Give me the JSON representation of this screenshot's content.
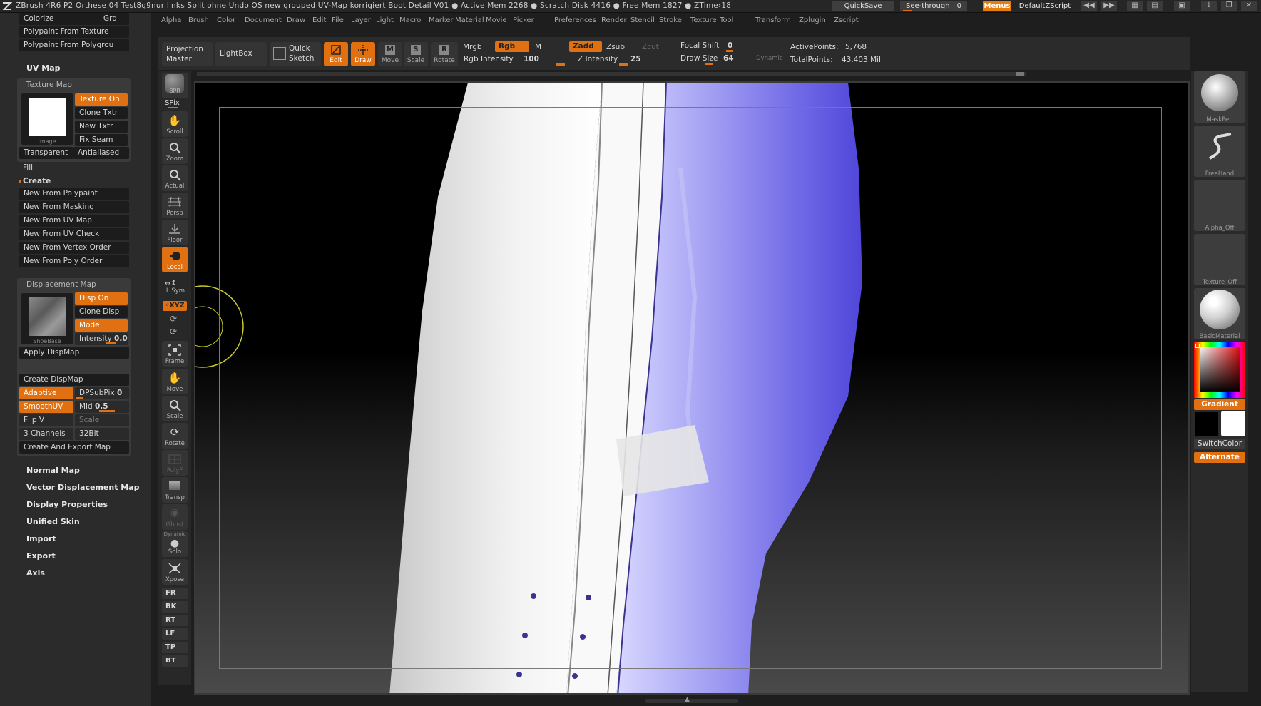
{
  "titlebar": {
    "title": "ZBrush 4R6 P2   Orthese 04 Test8g9nur links Split ohne Undo OS new grouped UV-Map korrigiert Boot Detail V01   ● Active Mem 2268 ● Scratch Disk 4416 ● Free Mem 1827 ● ZTime›18",
    "quicksave": "QuickSave",
    "seethrough_label": "See-through",
    "seethrough_value": "0",
    "menus": "Menus",
    "script": "DefaultZScript"
  },
  "menubar": {
    "items": [
      "Alpha",
      "Brush",
      "Color",
      "Document",
      "Draw",
      "Edit",
      "File",
      "Layer",
      "Light",
      "Macro",
      "Marker",
      "Material",
      "Movie",
      "Picker",
      "Preferences",
      "Render",
      "Stencil",
      "Stroke",
      "Texture",
      "Tool",
      "Transform",
      "Zplugin",
      "Zscript"
    ]
  },
  "left": {
    "colorize": "Colorize",
    "grd": "Grd",
    "polypaint_from_texture": "Polypaint From Texture",
    "polypaint_from_polygroups": "Polypaint From Polygrou",
    "uv_map": "UV Map",
    "texture_map": {
      "header": "Texture Map",
      "texture_on": "Texture On",
      "clone_txtr": "Clone Txtr",
      "new_txtr": "New Txtr",
      "fix_seam": "Fix Seam",
      "image_caption": "Image",
      "transparent": "Transparent",
      "antialiased": "Antialiased",
      "fill": "Fill",
      "create": "Create",
      "new_from": [
        "New From Polypaint",
        "New From Masking",
        "New From UV Map",
        "New From UV Check",
        "New From Vertex Order",
        "New From Poly Order"
      ]
    },
    "displacement_map": {
      "header": "Displacement Map",
      "disp_on": "Disp On",
      "clone_disp": "Clone Disp",
      "mode": "Mode",
      "intensity_label": "Intensity",
      "intensity_value": "0.0",
      "image_caption": "ShoeBase",
      "apply": "Apply DispMap",
      "create": "Create DispMap",
      "adaptive": "Adaptive",
      "dpsubpix_label": "DPSubPix",
      "dpsubpix_value": "0",
      "smoothuv": "SmoothUV",
      "mid_label": "Mid",
      "mid_value": "0.5",
      "flip_v": "Flip V",
      "scale": "Scale",
      "channels": "3 Channels",
      "bits": "32Bit",
      "create_export": "Create And Export Map"
    },
    "sections": [
      "Normal Map",
      "Vector Displacement Map",
      "Display Properties",
      "Unified Skin",
      "Import",
      "Export",
      "Axis"
    ]
  },
  "toolbar": {
    "projection_master": [
      "Projection",
      "Master"
    ],
    "lightbox": "LightBox",
    "quick_sketch": [
      "Quick",
      "Sketch"
    ],
    "edit": "Edit",
    "draw": "Draw",
    "move": "Move",
    "scale": "Scale",
    "rotate": "Rotate",
    "mrgb": "Mrgb",
    "rgb": "Rgb",
    "m": "M",
    "rgb_intensity_label": "Rgb Intensity",
    "rgb_intensity_value": "100",
    "zadd": "Zadd",
    "zsub": "Zsub",
    "zcut": "Zcut",
    "z_intensity_label": "Z Intensity",
    "z_intensity_value": "25",
    "focal_shift_label": "Focal Shift",
    "focal_shift_value": "0",
    "draw_size_label": "Draw Size",
    "draw_size_value": "64",
    "dynamic": "Dynamic",
    "active_points_label": "ActivePoints:",
    "active_points_value": "5,768",
    "total_points_label": "TotalPoints:",
    "total_points_value": "43.403 Mil"
  },
  "left_shelf": {
    "bpr": "BPR",
    "spix": "SPix",
    "scroll": "Scroll",
    "zoom": "Zoom",
    "actual": "Actual",
    "persp": "Persp",
    "floor": "Floor",
    "local": "Local",
    "lsym": "L.Sym",
    "xyz": "◦XYZ",
    "frame": "Frame",
    "move": "Move",
    "scale": "Scale",
    "rotate": "Rotate",
    "polyf": "PolyF",
    "transp": "Transp",
    "ghost": "Ghost",
    "dynamic": "Dynamic",
    "solo": "Solo",
    "xpose": "Xpose",
    "views": [
      "FR",
      "BK",
      "RT",
      "LF",
      "TP",
      "BT"
    ]
  },
  "right_shelf": {
    "maskpen": "MaskPen",
    "freehand": "FreeHand",
    "alpha_off": "Alpha_Off",
    "texture_off": "Texture_Off",
    "material": "BasicMaterial",
    "gradient": "Gradient",
    "switchcolor": "SwitchColor",
    "alternate": "Alternate"
  },
  "colors": {
    "accent": "#e07010",
    "panel": "#2b2b2b",
    "model_white": "#f4f4f4",
    "model_blue": "#6a62e8"
  }
}
